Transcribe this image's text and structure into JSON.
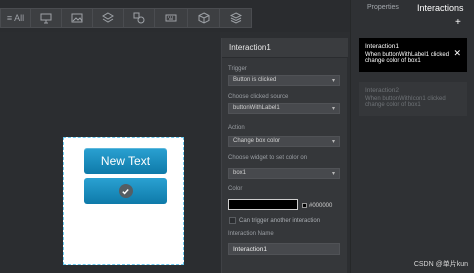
{
  "toolbar": {
    "buttons": [
      {
        "label": "≡ All",
        "icon": "list-icon"
      },
      {
        "label": "",
        "icon": "monitor-icon"
      },
      {
        "label": "",
        "icon": "image-icon"
      },
      {
        "label": "",
        "icon": "stack-icon"
      },
      {
        "label": "",
        "icon": "shapes-icon"
      },
      {
        "label": "",
        "icon": "keyboard-icon"
      },
      {
        "label": "",
        "icon": "cube-icon"
      },
      {
        "label": "",
        "icon": "layers-icon"
      }
    ]
  },
  "canvas": {
    "widgets": [
      {
        "name": "buttonWithLabel1",
        "label": "New Text"
      },
      {
        "name": "buttonWithIcon1",
        "icon": "check-icon"
      }
    ]
  },
  "editor": {
    "title": "Interaction1",
    "trigger_label": "Trigger",
    "trigger_value": "Button is clicked",
    "source_label": "Choose clicked source",
    "source_value": "buttonWithLabel1",
    "action_label": "Action",
    "action_value": "Change box color",
    "widget_label": "Choose widget to set color on",
    "widget_value": "box1",
    "color_label": "Color",
    "color_hex": "#000000",
    "color_value": "#000000",
    "trigger_another_label": "Can trigger another interaction",
    "name_label": "Interaction Name",
    "name_value": "Interaction1"
  },
  "right_panel": {
    "tab_properties": "Properties",
    "tab_interactions": "Interactions",
    "add_label": "+",
    "cards": [
      {
        "title": "Interaction1",
        "line1": "When buttonWithLabel1 clicked",
        "line2": "change color of box1",
        "close": "✕"
      },
      {
        "title": "Interaction2",
        "line1": "When buttonWithIcon1 clicked",
        "line2": "change color of box1"
      }
    ]
  },
  "watermark": "CSDN @单片kun"
}
